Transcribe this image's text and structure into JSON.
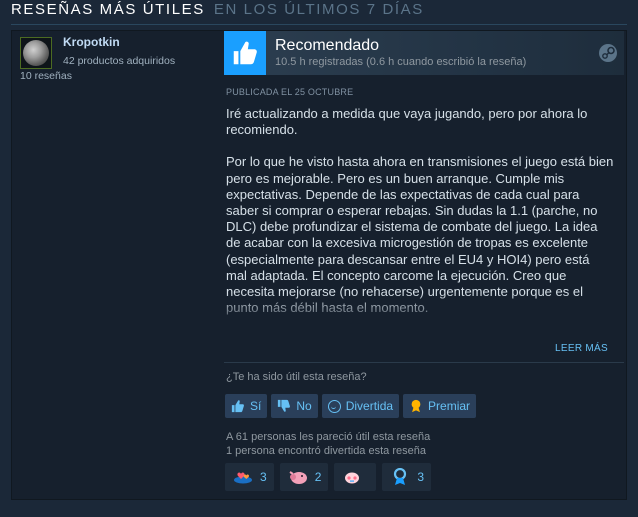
{
  "header": {
    "title": "Reseñas más útiles",
    "subtitle": "En los últimos 7 días"
  },
  "reviewer": {
    "name": "Kropotkin",
    "products": "42 productos adquiridos",
    "reviews": "10 reseñas",
    "avatar_icon": "moon-avatar"
  },
  "review": {
    "verdict": "Recomendado",
    "hours": "10.5 h registradas (0.6 h cuando escribió la reseña)",
    "posted": "Publicada el 25 octubre",
    "paragraph_1": "Iré actualizando a medida que vaya jugando, pero por ahora lo recomiendo.",
    "paragraph_2": "Por lo que he visto hasta ahora en transmisiones el juego está bien pero es mejorable. Pero es un buen arranque. Cumple mis expectativas. Depende de las expectativas de cada cual para saber si comprar o esperar rebajas. Sin dudas la 1.1 (parche, no DLC) debe profundizar el sistema de combate del juego. La idea de acabar con la excesiva microgestión de tropas es excelente (especialmente para descansar entre el EU4 y HOI4) pero está mal adaptada. El concepto carcome la ejecución. Creo que necesita mejorarse (no rehacerse) urgentemente porque es el punto más débil hasta el momento.",
    "read_more": "Leer más"
  },
  "feedback": {
    "question": "¿Te ha sido útil esta reseña?",
    "buttons": {
      "yes": "Sí",
      "no": "No",
      "funny": "Divertida",
      "award": "Premiar"
    },
    "helpful_stat": "A 61 personas les pareció útil esta reseña",
    "funny_stat": "1 persona encontró divertida esta reseña"
  },
  "awards": [
    {
      "icon": "hearts-award-icon",
      "count": "3"
    },
    {
      "icon": "pig-award-icon",
      "count": "2"
    },
    {
      "icon": "blush-award-icon",
      "count": ""
    },
    {
      "icon": "medal-award-icon",
      "count": "3"
    }
  ],
  "colors": {
    "accent": "#66c0f4",
    "thumb_bg": "#1a9fff",
    "page_bg": "#1b2838",
    "card_bg": "#16202d"
  }
}
